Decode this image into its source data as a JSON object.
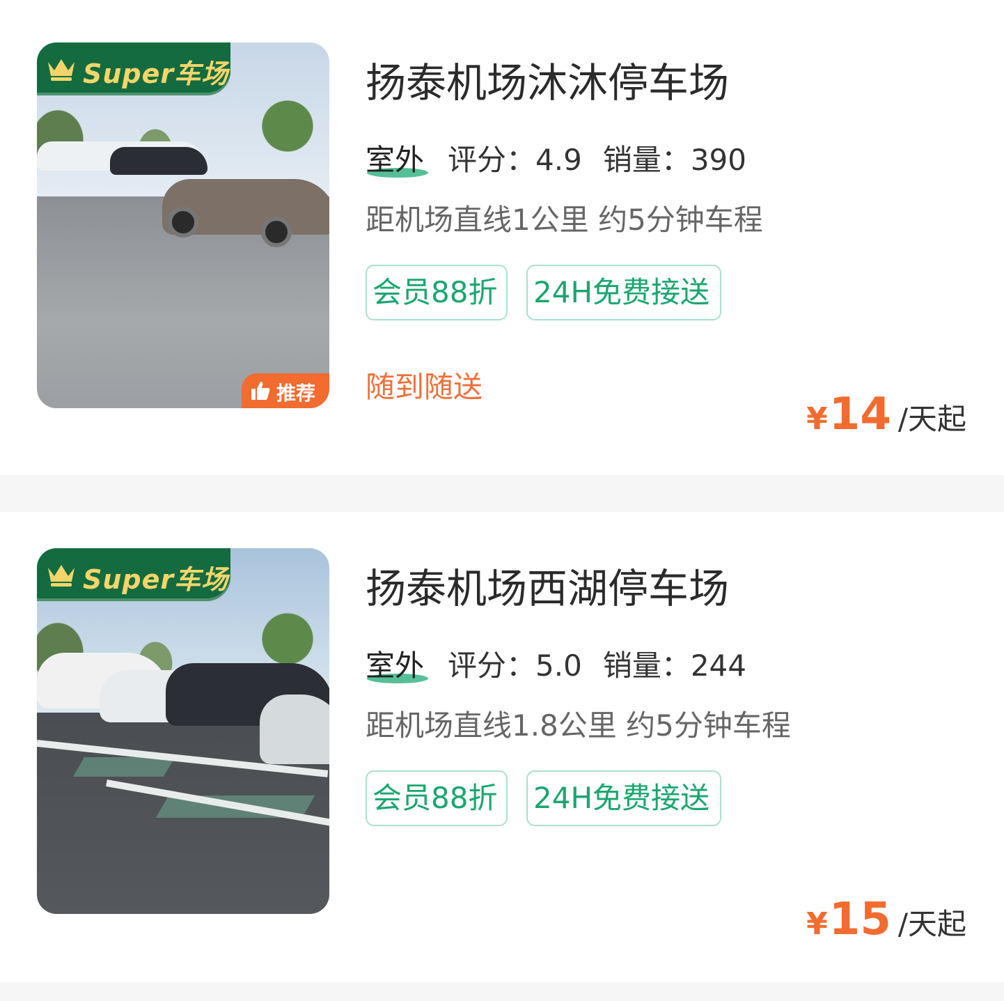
{
  "colors": {
    "brand_green": "#136b3f",
    "super_text": "#f5d56a",
    "accent_orange": "#f26b2f",
    "tag_green": "#1aa66f",
    "tag_border": "#a9e1cc"
  },
  "listings": [
    {
      "badge": "Super车场",
      "badge_icon": "crown-icon",
      "recommend": "推荐",
      "recommend_icon": "thumbs-up-icon",
      "title": "扬泰机场沐沐停车场",
      "type": "室外",
      "rating": "评分：4.9",
      "sales": "销量：390",
      "distance": "距机场直线1公里 约5分钟车程",
      "tags": [
        "会员88折",
        "24H免费接送"
      ],
      "shuttle": "随到随送",
      "currency": "¥",
      "price": "14",
      "unit": "/天起"
    },
    {
      "badge": "Super车场",
      "badge_icon": "crown-icon",
      "title": "扬泰机场西湖停车场",
      "type": "室外",
      "rating": "评分：5.0",
      "sales": "销量：244",
      "distance": "距机场直线1.8公里 约5分钟车程",
      "tags": [
        "会员88折",
        "24H免费接送"
      ],
      "currency": "¥",
      "price": "15",
      "unit": "/天起"
    }
  ]
}
